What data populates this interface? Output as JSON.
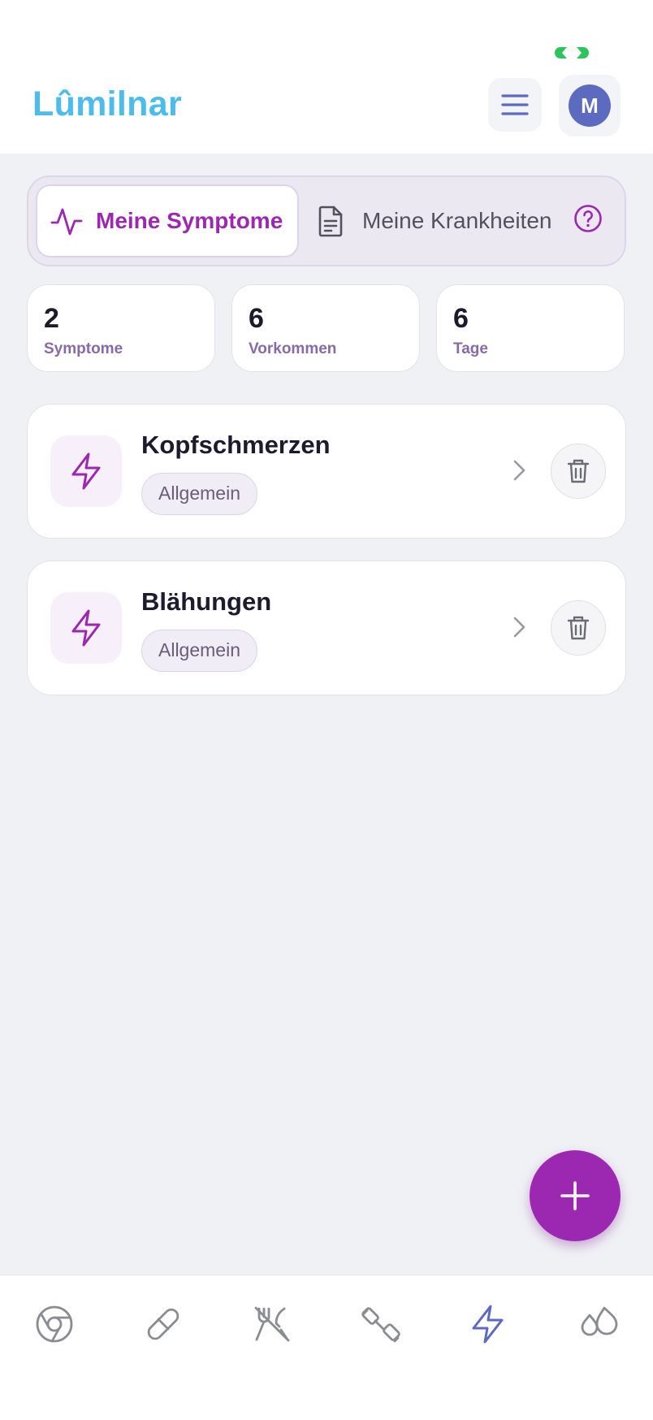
{
  "header": {
    "brand": "Lûmilnar",
    "avatar_initial": "M",
    "menu_icon": "hamburger-menu-icon",
    "status_indicator_color": "#2ec45c"
  },
  "tabs": [
    {
      "label": "Meine Symptome",
      "icon": "activity-pulse-icon",
      "active": true
    },
    {
      "label": "Meine Krankheiten",
      "icon": "document-icon",
      "active": false
    }
  ],
  "help_icon": "help-circle-icon",
  "stats": [
    {
      "value": "2",
      "label": "Symptome"
    },
    {
      "value": "6",
      "label": "Vorkommen"
    },
    {
      "value": "6",
      "label": "Tage"
    }
  ],
  "symptoms": [
    {
      "name": "Kopfschmerzen",
      "category": "Allgemein",
      "icon": "lightning-icon"
    },
    {
      "name": "Blähungen",
      "category": "Allgemein",
      "icon": "lightning-icon"
    }
  ],
  "fab_icon": "plus-icon",
  "bottom_nav": [
    {
      "icon": "chrome-icon",
      "active": false
    },
    {
      "icon": "pill-icon",
      "active": false
    },
    {
      "icon": "utensils-off-icon",
      "active": false
    },
    {
      "icon": "dumbbell-icon",
      "active": false
    },
    {
      "icon": "lightning-icon",
      "active": true
    },
    {
      "icon": "droplets-icon",
      "active": false
    }
  ],
  "colors": {
    "brand": "#4cbcec",
    "accent": "#9c27b0",
    "avatar": "#5c6bc0",
    "nav_active": "#5c6bc0",
    "nav_inactive": "#8b8b93",
    "background": "#f0f1f5"
  }
}
